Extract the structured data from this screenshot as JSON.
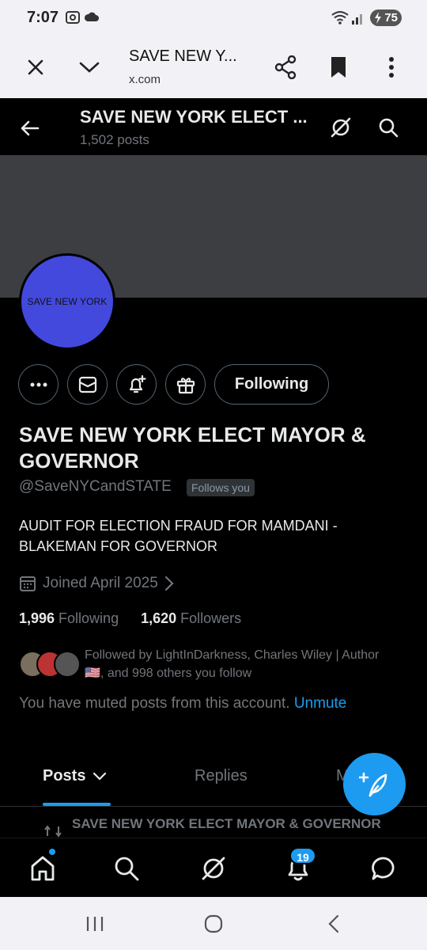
{
  "status_bar": {
    "time": "7:07",
    "battery": "75"
  },
  "browser": {
    "page_title": "SAVE NEW Y...",
    "url": "x.com"
  },
  "profile_header": {
    "name": "SAVE NEW YORK ELECT ...",
    "post_count": "1,502 posts"
  },
  "avatar": {
    "text": "SAVE NEW YORK"
  },
  "buttons": {
    "following_label": "Following"
  },
  "profile": {
    "display_name": "SAVE NEW YORK ELECT MAYOR & GOVERNOR",
    "handle": "@SaveNYCandSTATE",
    "follows_you": "Follows you",
    "bio": "AUDIT FOR ELECTION FRAUD FOR MAMDANI - BLAKEMAN FOR GOVERNOR",
    "joined": "Joined April 2025",
    "following_count": "1,996",
    "following_label": "Following",
    "followers_count": "1,620",
    "followers_label": "Followers",
    "followed_by": "Followed by LightInDarkness, Charles Wiley | Author 🇺🇸, and 998 others you follow",
    "muted_text": "You have muted posts from this account.",
    "unmute_label": "Unmute"
  },
  "tabs": [
    {
      "label": "Posts"
    },
    {
      "label": "Replies"
    },
    {
      "label": "M"
    }
  ],
  "repost_preview": "SAVE NEW YORK ELECT MAYOR & GOVERNOR",
  "bottom_nav": {
    "notifications_badge": "19"
  },
  "colors": {
    "accent": "#1d9bf0",
    "avatar_bg": "#4349dc",
    "banner": "#3c3e41"
  }
}
